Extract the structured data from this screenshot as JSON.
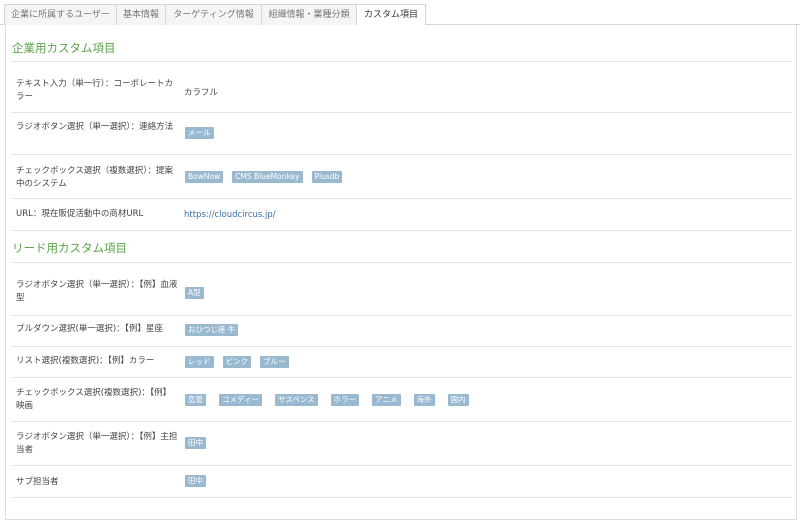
{
  "tabs": [
    {
      "label": "企業に所属するユーザー"
    },
    {
      "label": "基本情報"
    },
    {
      "label": "ターゲティング情報"
    },
    {
      "label": "組織情報・業種分類"
    },
    {
      "label": "カスタム項目"
    }
  ],
  "company_section": {
    "title": "企業用カスタム項目",
    "rows": [
      {
        "label": "テキスト入力（単一行）：コーポレートカラー",
        "value": "カラフル"
      },
      {
        "label": "ラジオボタン選択（単一選択）：連絡方法",
        "tags": [
          "メール"
        ]
      },
      {
        "label": "チェックボックス選択（複数選択）：提案中のシステム",
        "tags": [
          "BowNow",
          "CMS BlueMonkey",
          "Plusdb"
        ]
      },
      {
        "label": "URL：現在販促活動中の商材URL",
        "link": "https://cloudcircus.jp/"
      }
    ]
  },
  "lead_section": {
    "title": "リード用カスタム項目",
    "rows": [
      {
        "label": "ラジオボタン選択（単一選択）：【例】血液型",
        "tags": [
          "A型"
        ]
      },
      {
        "label": "プルダウン選択(単一選択)：【例】星座",
        "tags": [
          "おひつじ座 牛"
        ]
      },
      {
        "label": "リスト選択(複数選択)：【例】カラー",
        "tags": [
          "レッド",
          "ピンク",
          "ブルー"
        ]
      },
      {
        "label": "チェックボックス選択(複数選択)：【例】映画",
        "tags": [
          "恋愛",
          "コメディー",
          "サスペンス",
          "ホラー",
          "アニメ",
          "海外",
          "国内"
        ]
      },
      {
        "label": "ラジオボタン選択（単一選択）：【例】主担当者",
        "tags": [
          "田中"
        ]
      },
      {
        "label": "サブ担当者",
        "tags": [
          "田中"
        ]
      }
    ]
  }
}
